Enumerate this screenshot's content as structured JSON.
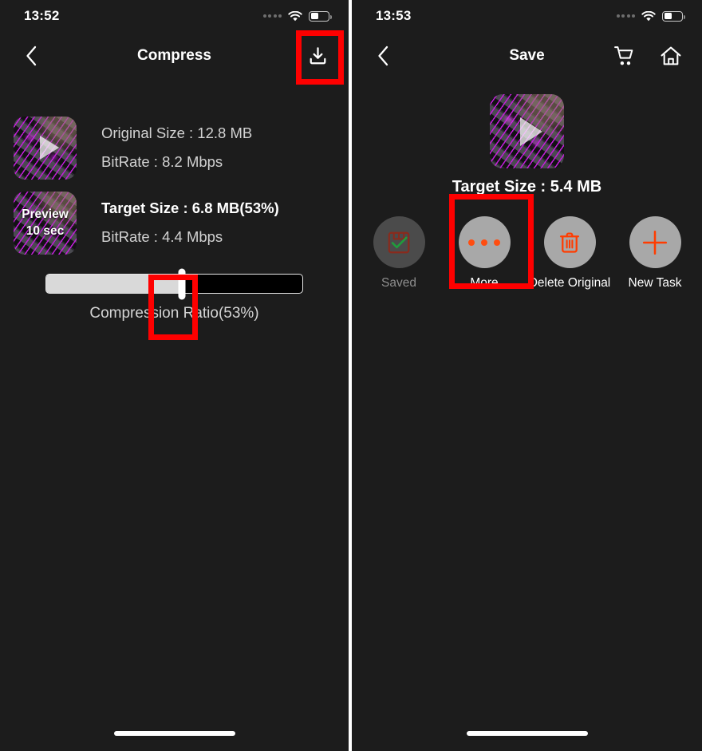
{
  "left": {
    "status": {
      "time": "13:52",
      "cellular_icon": "cellular-dots-icon",
      "wifi_icon": "wifi-icon",
      "battery_icon": "battery-icon",
      "battery_percent": 45
    },
    "nav": {
      "back_icon": "chevron-left-icon",
      "title": "Compress",
      "download_icon": "download-icon"
    },
    "rows": [
      {
        "thumb_icon": "video-thumbnail-play-icon",
        "line1": "Original Size : 12.8 MB",
        "line2": "BitRate : 8.2 Mbps",
        "emphasis": false
      },
      {
        "thumb_icon": "video-thumbnail-preview-icon",
        "preview_label": "Preview",
        "preview_duration": "10 sec",
        "line1": "Target Size : 6.8 MB(53%)",
        "line2": "BitRate : 4.4 Mbps",
        "emphasis": true
      }
    ],
    "slider": {
      "label": "Compression Ratio(53%)",
      "value": 53,
      "min": 0,
      "max": 100
    }
  },
  "right": {
    "status": {
      "time": "13:53",
      "cellular_icon": "cellular-dots-icon",
      "wifi_icon": "wifi-icon",
      "battery_icon": "battery-icon",
      "battery_percent": 45
    },
    "nav": {
      "back_icon": "chevron-left-icon",
      "title": "Save",
      "cart_icon": "shopping-cart-icon",
      "home_icon": "home-icon"
    },
    "hero": {
      "thumb_icon": "video-thumbnail-play-icon",
      "target_size": "Target Size : 5.4 MB"
    },
    "actions": [
      {
        "label": "Saved",
        "icon": "floppy-disk-check-icon",
        "disabled": true
      },
      {
        "label": "More",
        "icon": "more-dots-icon",
        "disabled": false
      },
      {
        "label": "Delete Original",
        "icon": "trash-icon",
        "disabled": false
      },
      {
        "label": "New Task",
        "icon": "plus-icon",
        "disabled": false
      }
    ]
  },
  "highlights": {
    "download_button": "red-highlight-box",
    "slider_thumb": "red-highlight-box",
    "more_button": "red-highlight-box"
  },
  "colors": {
    "background": "#1c1c1c",
    "highlight": "#fe0000",
    "accent_orange": "#ff4d10",
    "circle_gray": "#a8a8a8",
    "circle_disabled": "#4b4b4b",
    "text_primary": "#ffffff",
    "text_secondary": "#d2d2d2"
  }
}
